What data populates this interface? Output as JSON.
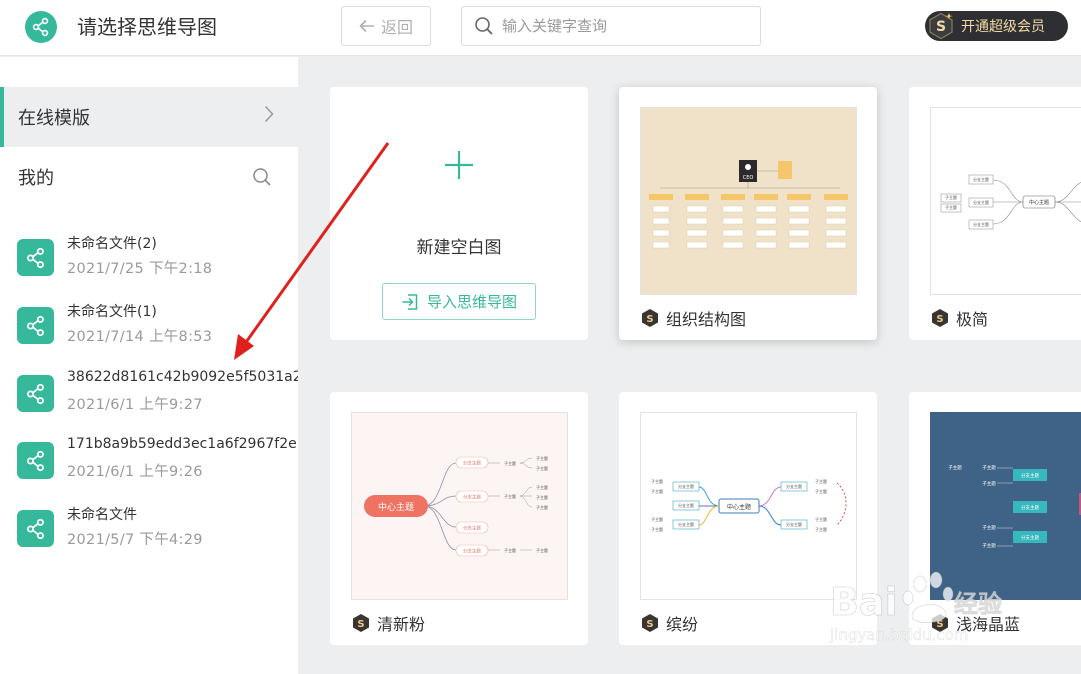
{
  "header": {
    "title": "请选择思维导图",
    "back_label": "返回",
    "search_placeholder": "输入关键字查询",
    "vip_label": "开通超级会员"
  },
  "sidebar": {
    "online_templates_label": "在线模版",
    "mine_label": "我的",
    "files": [
      {
        "name": "未命名文件(2)",
        "date": "2021/7/25 下午2:18"
      },
      {
        "name": "未命名文件(1)",
        "date": "2021/7/14 上午8:53"
      },
      {
        "name": "38622d8161c42b9092e5f5031a2",
        "date": "2021/6/1 上午9:27"
      },
      {
        "name": "171b8a9b59edd3ec1a6f2967f2e",
        "date": "2021/6/1 上午9:26"
      },
      {
        "name": "未命名文件",
        "date": "2021/5/7 下午4:29"
      }
    ]
  },
  "templates": {
    "new_blank_label": "新建空白图",
    "import_label": "导入思维导图",
    "items": [
      {
        "label": "组织结构图"
      },
      {
        "label": "极简"
      },
      {
        "label": "清新粉"
      },
      {
        "label": "缤纷"
      },
      {
        "label": "浅海晶蓝"
      }
    ]
  },
  "thumbs": {
    "ceo": "CEO",
    "center_topic": "中心主题",
    "branch_topic": "分支主题",
    "sub_topic": "子主题"
  },
  "watermark": {
    "brand": "Bai",
    "brand_suffix": "经验",
    "url": "jingyan.baidu.com"
  },
  "colors": {
    "accent": "#36b99a",
    "arrow": "#e0201b",
    "vip_bg": "#2d2f32",
    "vip_text": "#f4d9a6"
  },
  "icons": {
    "logo": "share-nodes-icon",
    "back": "arrow-left-icon",
    "search": "search-icon",
    "vip": "s-badge-icon",
    "chevron": "chevron-right-icon",
    "plus": "plus-icon",
    "import": "import-icon"
  }
}
